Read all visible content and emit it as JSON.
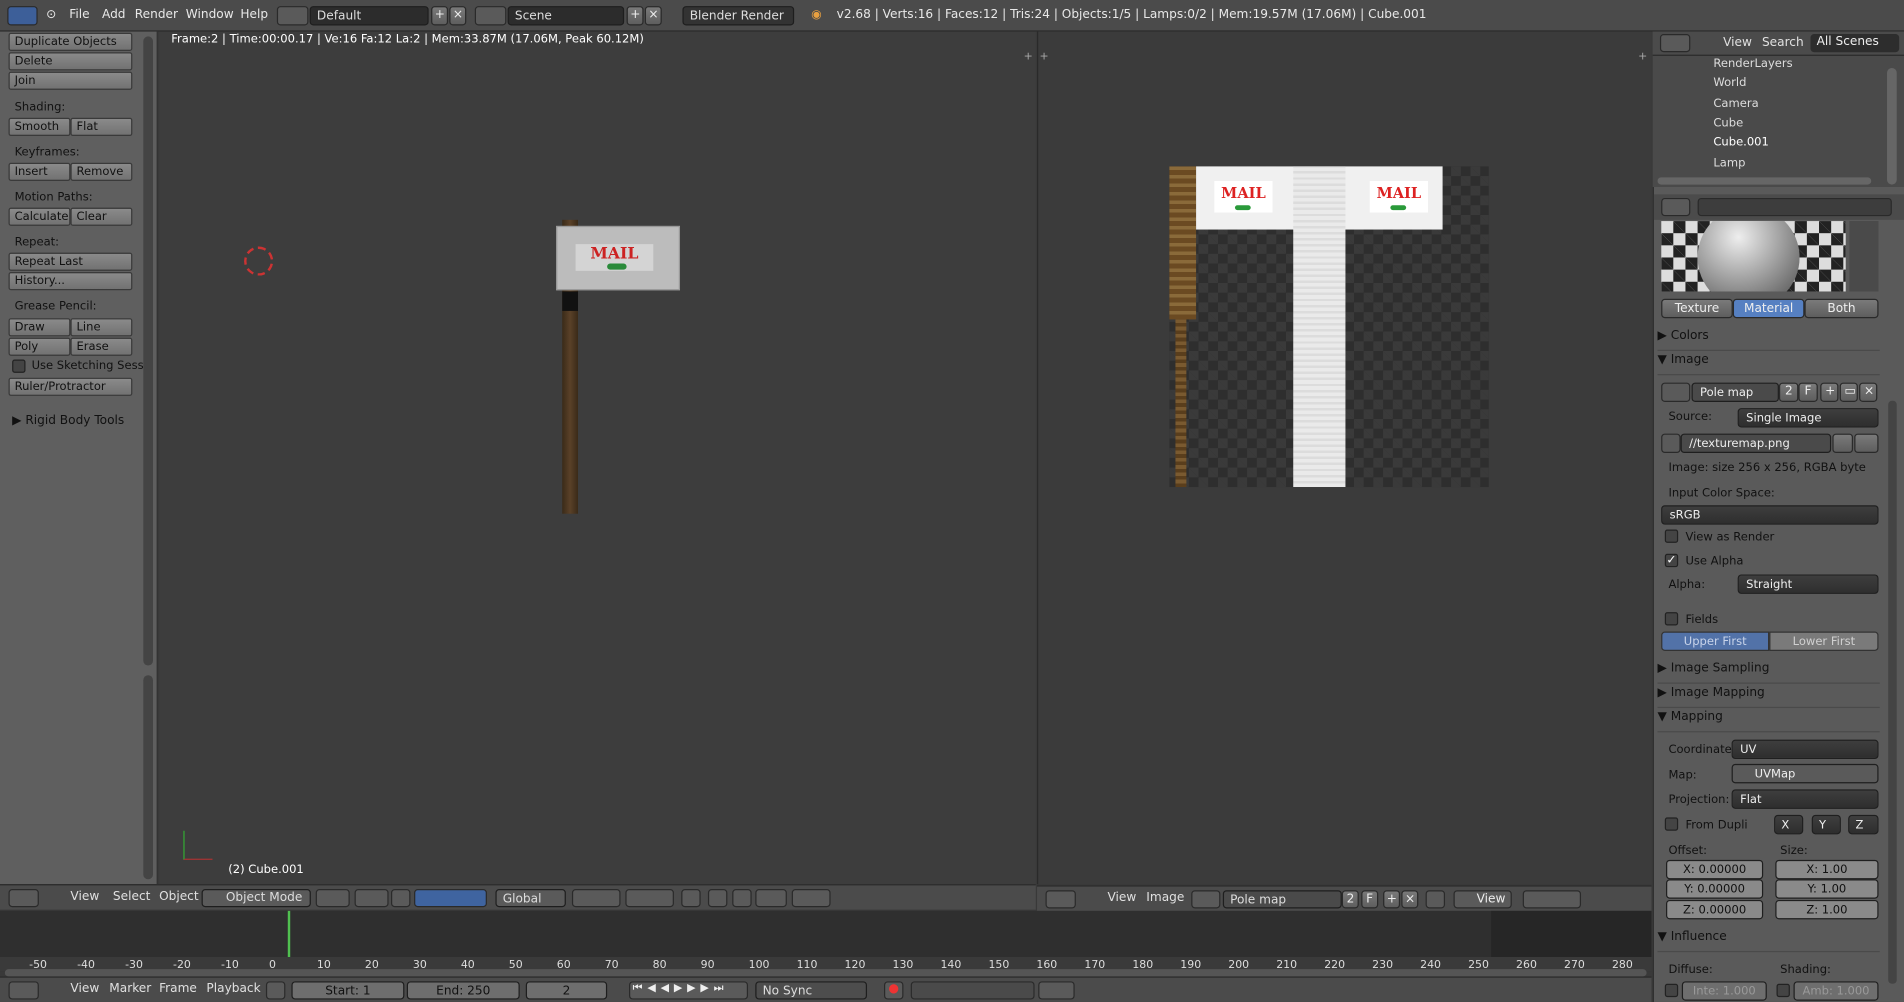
{
  "topbar": {
    "menus": [
      "File",
      "Add",
      "Render",
      "Window",
      "Help"
    ],
    "layout": "Default",
    "scene": "Scene",
    "engine": "Blender Render",
    "stats": "v2.68 | Verts:16 | Faces:12 | Tris:24 | Objects:1/5 | Lamps:0/2 | Mem:19.57M (17.06M) | Cube.001"
  },
  "toolshelf": {
    "buttons_top": [
      "Duplicate Objects",
      "Delete",
      "Join"
    ],
    "shading_label": "Shading:",
    "smooth": "Smooth",
    "flat": "Flat",
    "keyframes_label": "Keyframes:",
    "insert": "Insert",
    "remove": "Remove",
    "motion_label": "Motion Paths:",
    "calculate": "Calculate",
    "clear": "Clear",
    "repeat_label": "Repeat:",
    "repeat_last": "Repeat Last",
    "history": "History...",
    "grease_label": "Grease Pencil:",
    "draw": "Draw",
    "line": "Line",
    "poly": "Poly",
    "erase": "Erase",
    "sketching": "Use Sketching Sessi",
    "ruler": "Ruler/Protractor",
    "rigid": "Rigid Body Tools"
  },
  "viewport": {
    "info": "Frame:2 | Time:00:00.17 | Ve:16 Fa:12 La:2 | Mem:33.87M (17.06M, Peak 60.12M)",
    "object_name": "(2) Cube.001",
    "sign_text": "MAIL",
    "header": {
      "view": "View",
      "select": "Select",
      "object": "Object",
      "mode": "Object Mode",
      "orientation": "Global"
    }
  },
  "uv_editor": {
    "sign_text_left": "MAIL",
    "sign_text_right": "MAIL",
    "header": {
      "view": "View",
      "image": "Image",
      "image_name": "Pole map",
      "users": "2",
      "fake": "F",
      "view_dd": "View"
    }
  },
  "outliner": {
    "view": "View",
    "search": "Search",
    "scope": "All Scenes",
    "items": [
      "RenderLayers",
      "World",
      "Camera",
      "Cube",
      "Cube.001",
      "Lamp"
    ]
  },
  "properties": {
    "tabs": [
      "Texture",
      "Material",
      "Both"
    ],
    "colors": "Colors",
    "image": "Image",
    "image_name": "Pole map",
    "users": "2",
    "fake": "F",
    "source_label": "Source:",
    "source": "Single Image",
    "filepath": "//texturemap.png",
    "size_info": "Image: size 256 x 256, RGBA byte",
    "color_space_label": "Input Color Space:",
    "color_space": "sRGB",
    "view_as_render": "View as Render",
    "use_alpha": "Use Alpha",
    "alpha_label": "Alpha:",
    "alpha": "Straight",
    "fields": "Fields",
    "upper_first": "Upper First",
    "lower_first": "Lower First",
    "image_sampling": "Image Sampling",
    "image_mapping": "Image Mapping",
    "mapping": "Mapping",
    "coordinate_label": "Coordinate",
    "coordinate": "UV",
    "map_label": "Map:",
    "map": "UVMap",
    "projection_label": "Projection:",
    "projection": "Flat",
    "from_dupli": "From Dupli",
    "x": "X",
    "y": "Y",
    "z": "Z",
    "offset_label": "Offset:",
    "size_label": "Size:",
    "offset_x": "X: 0.00000",
    "offset_y": "Y: 0.00000",
    "offset_z": "Z: 0.00000",
    "size_x": "X: 1.00",
    "size_y": "Y: 1.00",
    "size_z": "Z: 1.00",
    "influence": "Influence",
    "diffuse_label": "Diffuse:",
    "shading_label": "Shading:",
    "intensity": "Inte: 1.000",
    "ambient": "Amb: 1.000"
  },
  "timeline": {
    "ticks": [
      "-50",
      "-40",
      "-30",
      "-20",
      "-10",
      "0",
      "10",
      "20",
      "30",
      "40",
      "50",
      "60",
      "70",
      "80",
      "90",
      "100",
      "110",
      "120",
      "130",
      "140",
      "150",
      "160",
      "170",
      "180",
      "190",
      "200",
      "210",
      "220",
      "230",
      "240",
      "250",
      "260",
      "270",
      "280"
    ],
    "view": "View",
    "marker": "Marker",
    "frame": "Frame",
    "playback": "Playback",
    "start": "Start: 1",
    "end": "End: 250",
    "current": "2",
    "sync": "No Sync"
  }
}
